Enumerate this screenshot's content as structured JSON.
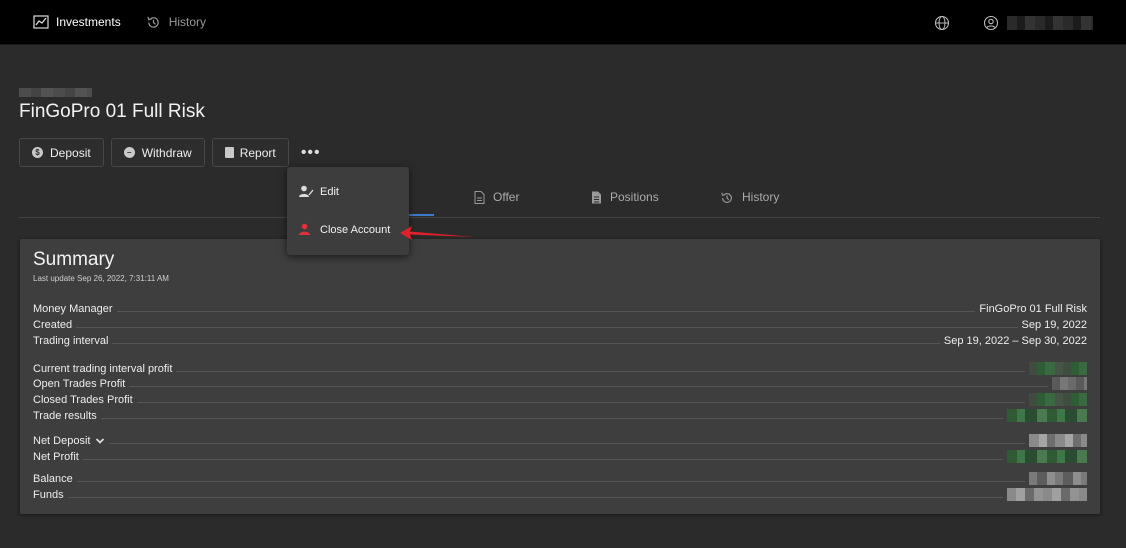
{
  "topbar": {
    "nav": [
      {
        "label": "Investments",
        "icon": "chart-line-icon"
      },
      {
        "label": "History",
        "icon": "history-icon"
      }
    ],
    "globe_icon": "globe-icon",
    "user_icon": "user-circle-icon"
  },
  "account": {
    "title": "FinGoPro 01 Full Risk"
  },
  "actions": {
    "deposit_label": "Deposit",
    "withdraw_label": "Withdraw",
    "report_label": "Report",
    "more_label": "•••"
  },
  "dropdown": {
    "items": [
      {
        "label": "Edit",
        "icon": "user-edit-icon"
      },
      {
        "label": "Close Account",
        "icon": "user-remove-icon"
      }
    ]
  },
  "tabs": [
    {
      "label": "Offer",
      "icon": "document-icon"
    },
    {
      "label": "Positions",
      "icon": "list-document-icon"
    },
    {
      "label": "History",
      "icon": "history-icon"
    }
  ],
  "summary": {
    "title": "Summary",
    "last_update": "Last update Sep 26, 2022, 7:31:11 AM",
    "rows": [
      {
        "label": "Money Manager",
        "value": "FinGoPro 01 Full Risk"
      },
      {
        "label": "Created",
        "value": "Sep 19, 2022"
      },
      {
        "label": "Trading interval",
        "value": "Sep 19, 2022 – Sep 30, 2022"
      },
      {
        "label": "Current trading interval profit",
        "value": ""
      },
      {
        "label": "Open Trades Profit",
        "value": ""
      },
      {
        "label": "Closed Trades Profit",
        "value": ""
      },
      {
        "label": "Trade results",
        "value": ""
      },
      {
        "label": "Net Deposit",
        "value": ""
      },
      {
        "label": "Net Profit",
        "value": ""
      },
      {
        "label": "Balance",
        "value": ""
      },
      {
        "label": "Funds",
        "value": ""
      }
    ]
  },
  "colors": {
    "accent": "#3d7ac7",
    "danger": "#e0303a",
    "background": "#2b2b2b",
    "topbar": "#000000"
  }
}
